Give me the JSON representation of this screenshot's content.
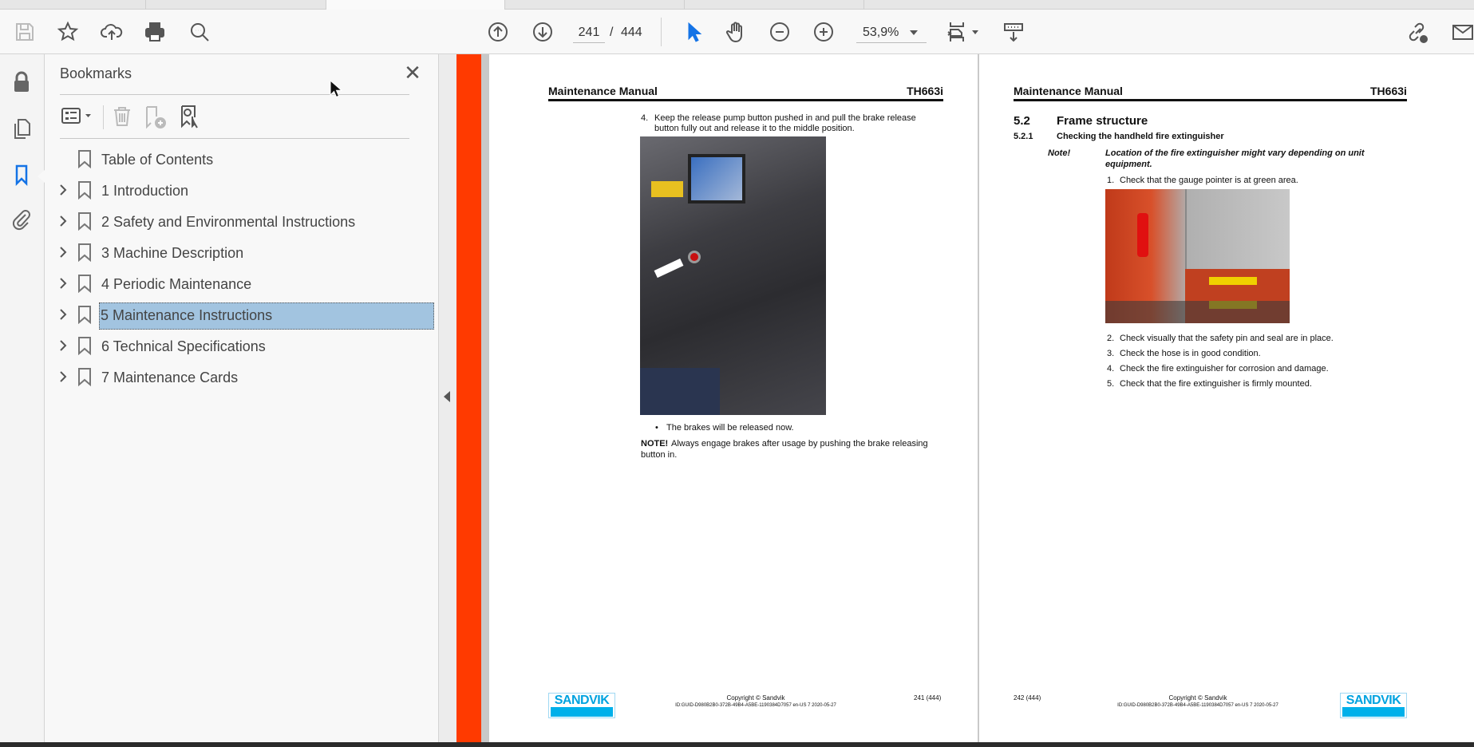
{
  "toolbar": {
    "current_page": "241",
    "page_separator": "/",
    "total_pages": "444",
    "zoom_level": "53,9%",
    "icons": [
      "save-icon",
      "bookmark-star-icon",
      "upload-cloud-icon",
      "print-icon",
      "find-zoom-icon",
      "previous-page-icon",
      "next-page-icon",
      "select-cursor-icon",
      "hand-tool-icon",
      "zoom-out-icon",
      "zoom-in-icon",
      "fit-page-icon",
      "scroll-mode-icon",
      "share-link-icon",
      "email-icon"
    ],
    "accent": "#1473e6"
  },
  "rail": {
    "icons": [
      "lock-icon",
      "pages-icon",
      "bookmarks-icon",
      "attachment-icon"
    ],
    "active": "bookmarks-icon"
  },
  "bookmarks": {
    "title": "Bookmarks",
    "items": [
      {
        "label": "Table of Contents",
        "expandable": false
      },
      {
        "label": "1 Introduction",
        "expandable": true
      },
      {
        "label": "2 Safety and Environmental Instructions",
        "expandable": true
      },
      {
        "label": "3 Machine Description",
        "expandable": true
      },
      {
        "label": "4 Periodic Maintenance",
        "expandable": true
      },
      {
        "label": "5 Maintenance Instructions",
        "expandable": true,
        "selected": true
      },
      {
        "label": "6 Technical Specifications",
        "expandable": true
      },
      {
        "label": "7 Maintenance Cards",
        "expandable": true
      }
    ],
    "selected_color": "#a2c4e0"
  },
  "page_left": {
    "header_title": "Maintenance Manual",
    "header_model": "TH663i",
    "step_number": "4.",
    "step_line1": "Keep the release pump button pushed in and pull the brake release",
    "step_line2": "button fully out and release it to the middle position.",
    "bullet": "•",
    "bullet_text": "The brakes will be released now.",
    "note_label": "NOTE!",
    "note_line1": "Always engage brakes after usage by pushing the brake releasing",
    "note_line2": "button in.",
    "logo": "SANDVIK",
    "copyright": "Copyright © Sandvik",
    "doc_id": "ID:GUID-D980B2B0-372B-49B4-A5BE-1190384D7057 en-US 7 2020-05-27",
    "page_number": "241 (444)"
  },
  "page_right": {
    "header_title": "Maintenance Manual",
    "header_model": "TH663i",
    "section_number": "5.2",
    "section_title": "Frame structure",
    "subsection_number": "5.2.1",
    "subsection_title": "Checking the handheld fire extinguisher",
    "note_label": "Note!",
    "note_line1": "Location of the fire extinguisher might vary depending on unit",
    "note_line2": "equipment.",
    "steps": [
      {
        "n": "1.",
        "text": "Check that the gauge pointer is at green area."
      },
      {
        "n": "2.",
        "text": "Check visually that the safety pin and seal are in place."
      },
      {
        "n": "3.",
        "text": "Check the hose is in good condition."
      },
      {
        "n": "4.",
        "text": "Check the fire extinguisher for corrosion and damage."
      },
      {
        "n": "5.",
        "text": "Check that the fire extinguisher is firmly mounted."
      }
    ],
    "logo": "SANDVIK",
    "copyright": "Copyright © Sandvik",
    "doc_id": "ID:GUID-D980B2B0-372B-49B4-A5BE-1190384D7057 en-US 7 2020-05-27",
    "page_number": "242 (444)"
  },
  "colors": {
    "brand": "#00a3e0",
    "side_bar": "#ff3a00"
  }
}
